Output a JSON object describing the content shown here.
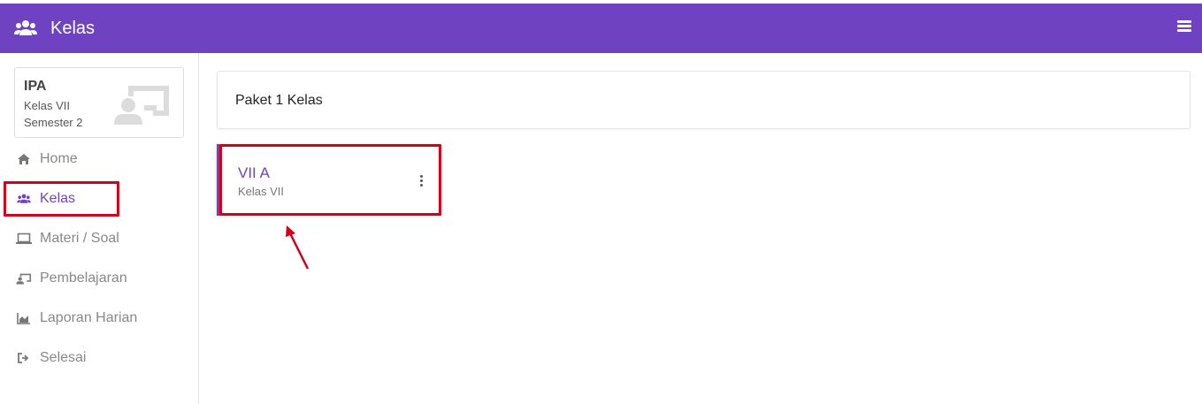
{
  "header": {
    "title": "Kelas",
    "icon": "users-icon",
    "menu_icon": "hamburger-menu-icon",
    "background_color": "#6f42c1"
  },
  "sidebar": {
    "profile": {
      "subject": "IPA",
      "class": "Kelas VII",
      "semester": "Semester 2",
      "icon": "teacher-board-icon"
    },
    "items": [
      {
        "label": "Home",
        "icon": "home-icon",
        "active": false
      },
      {
        "label": "Kelas",
        "icon": "users-icon",
        "active": true
      },
      {
        "label": "Materi / Soal",
        "icon": "laptop-icon",
        "active": false
      },
      {
        "label": "Pembelajaran",
        "icon": "teacher-board-icon",
        "active": false
      },
      {
        "label": "Laporan Harian",
        "icon": "area-chart-icon",
        "active": false
      },
      {
        "label": "Selesai",
        "icon": "sign-out-icon",
        "active": false
      }
    ]
  },
  "main": {
    "header": "Paket 1 Kelas",
    "classes": [
      {
        "name": "VII A",
        "subtitle": "Kelas VII",
        "menu_icon": "kebab-menu-icon"
      }
    ]
  },
  "annotation_color": "#d0021b",
  "accent_color": "#6f42c1"
}
